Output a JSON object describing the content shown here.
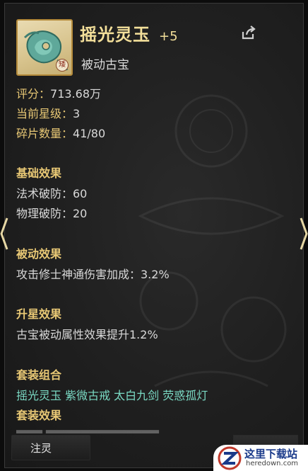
{
  "item": {
    "name": "摇光灵玉",
    "level": "+5",
    "type": "被动古宝",
    "badge": "矮"
  },
  "stats": [
    {
      "label": "评分：",
      "value": "713.68万"
    },
    {
      "label": "当前星级：",
      "value": "3"
    },
    {
      "label": "碎片数量：",
      "value": "41/80"
    }
  ],
  "sections": {
    "base": {
      "title": "基础效果",
      "lines": [
        "法术破防：60",
        "物理破防：20"
      ]
    },
    "passive": {
      "title": "被动效果",
      "lines": [
        "攻击修士神通伤害加成：3.2%"
      ]
    },
    "star": {
      "title": "升星效果",
      "lines": [
        "古宝被动属性效果提升1.2%"
      ]
    },
    "set_combo": {
      "title": "套装组合",
      "lines": [
        "摇光灵玉 紫微古戒 太白九剑 荧惑孤灯"
      ]
    },
    "set_effect": {
      "title": "套装效果"
    }
  },
  "buttons": {
    "infuse_label": "注灵"
  },
  "watermark": {
    "title": "这里下载站",
    "url": "heredown.com"
  },
  "colors": {
    "title_gold": "#f3df9a",
    "label_gold": "#e8c875",
    "set_teal": "#7ad9c3",
    "text": "#d9d9d9"
  },
  "icons": {
    "share": "share-icon",
    "nav_prev": "chevron-left-icon",
    "nav_next": "chevron-right-icon"
  }
}
